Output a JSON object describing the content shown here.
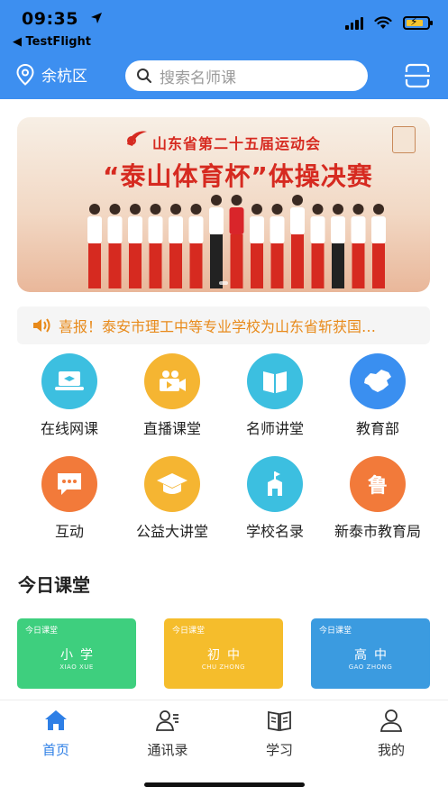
{
  "status": {
    "time": "09:35",
    "back_app": "◀ TestFlight"
  },
  "header": {
    "location": "余杭区",
    "search_placeholder": "搜索名师课"
  },
  "banner": {
    "title_line1": "山东省第二十五届运动会",
    "title_line2": "“泰山体育杯”体操决赛"
  },
  "notice": {
    "text": "喜报！泰安市理工中等专业学校为山东省斩获国…"
  },
  "grid": [
    {
      "label": "在线网课",
      "icon": "laptop-icon",
      "color": "#3cbfe0"
    },
    {
      "label": "直播课堂",
      "icon": "video-icon",
      "color": "#f5b532"
    },
    {
      "label": "名师讲堂",
      "icon": "book-icon",
      "color": "#3cbfe0"
    },
    {
      "label": "教育部",
      "icon": "china-map-icon",
      "color": "#3a8ff0"
    },
    {
      "label": "互动",
      "icon": "chat-icon",
      "color": "#f27a3a"
    },
    {
      "label": "公益大讲堂",
      "icon": "graduation-cap-icon",
      "color": "#f5b532"
    },
    {
      "label": "学校名录",
      "icon": "school-icon",
      "color": "#3cbfe0"
    },
    {
      "label": "新泰市教育局",
      "icon": "lu-icon",
      "color": "#f27a3a",
      "glyph": "鲁"
    }
  ],
  "section": {
    "title": "今日课堂"
  },
  "cards": [
    {
      "tag": "今日课堂",
      "main": "小学",
      "sub": "XIAO XUE",
      "color": "#3ecf7e"
    },
    {
      "tag": "今日课堂",
      "main": "初中",
      "sub": "CHU ZHONG",
      "color": "#f5bd2c"
    },
    {
      "tag": "今日课堂",
      "main": "高中",
      "sub": "GAO ZHONG",
      "color": "#3b9be0"
    }
  ],
  "tabs": [
    {
      "label": "首页",
      "icon": "home-icon",
      "active": true
    },
    {
      "label": "通讯录",
      "icon": "contacts-icon",
      "active": false
    },
    {
      "label": "学习",
      "icon": "open-book-icon",
      "active": false
    },
    {
      "label": "我的",
      "icon": "user-icon",
      "active": false
    }
  ],
  "colors": {
    "header": "#3d8ff0",
    "notice_text": "#e88a1a",
    "tab_active": "#2e7fe6"
  }
}
